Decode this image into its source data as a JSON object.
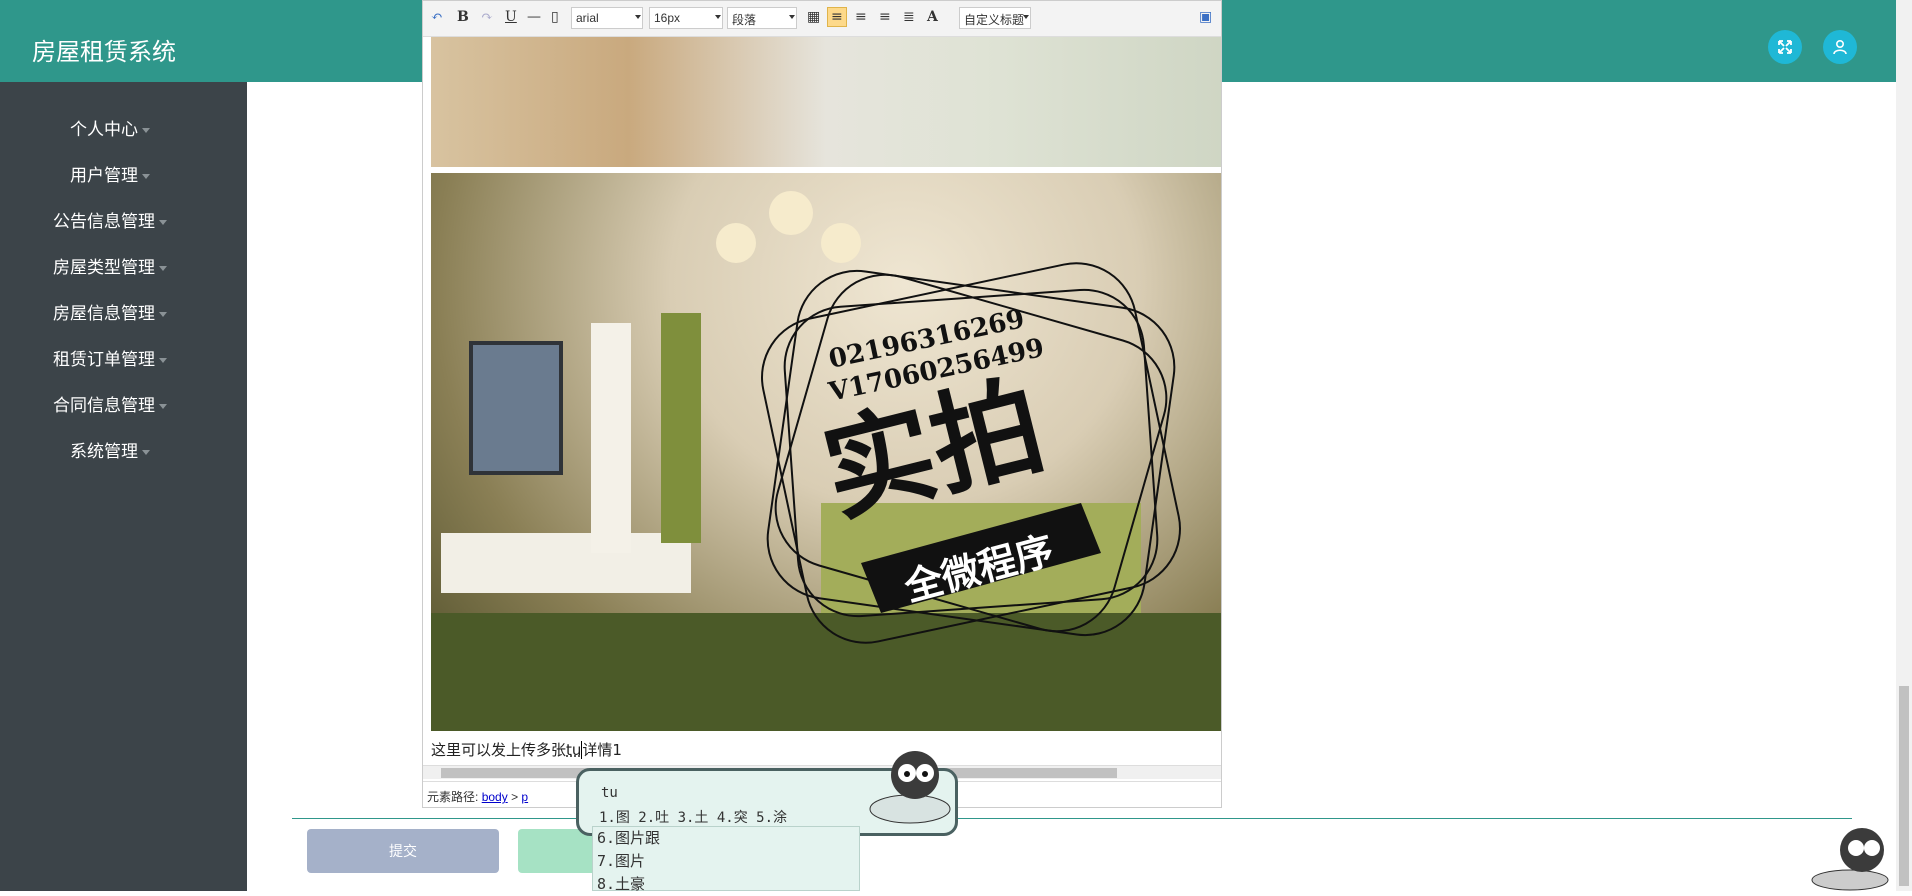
{
  "header": {
    "app_title": "房屋租赁系统",
    "fullscreen_icon": "expand-icon",
    "user_icon": "user-icon",
    "bg_color": "#2f978b"
  },
  "sidebar": {
    "items": [
      {
        "label": "个人中心"
      },
      {
        "label": "用户管理"
      },
      {
        "label": "公告信息管理"
      },
      {
        "label": "房屋类型管理"
      },
      {
        "label": "房屋信息管理"
      },
      {
        "label": "租赁订单管理"
      },
      {
        "label": "合同信息管理"
      },
      {
        "label": "系统管理"
      }
    ]
  },
  "editor": {
    "toolbar": {
      "bold": "B",
      "underline": "U",
      "font_color": "A",
      "font_family": "arial",
      "font_size": "16px",
      "paragraph": "段落",
      "custom_title": "自定义标题"
    },
    "watermark": {
      "phone1": "02196316269",
      "phone2": "V17060256499",
      "stamp": "实拍",
      "banner": "全微程序"
    },
    "text_before": "这里可以发上传多张",
    "text_typing": "tu",
    "text_after": "详情1",
    "path_label": "元素路径:",
    "path_body": "body",
    "path_sep": ">",
    "path_p": "p"
  },
  "ime": {
    "composition": "tu",
    "candidates_row": "1.图 2.吐 3.土 4.突 5.涂",
    "list": [
      "6.图片跟",
      "7.图片",
      "8.土豪"
    ]
  },
  "buttons": {
    "submit": "提交"
  }
}
